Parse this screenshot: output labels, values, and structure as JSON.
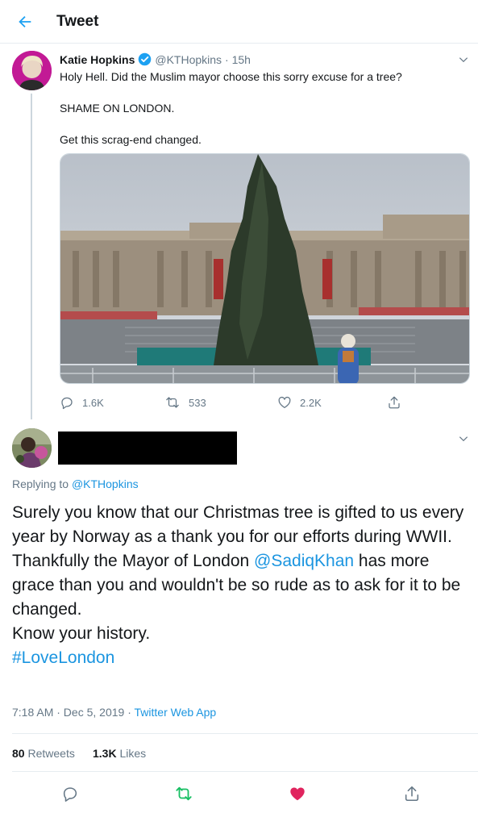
{
  "header": {
    "title": "Tweet"
  },
  "tweet1": {
    "name": "Katie Hopkins",
    "handle": "@KTHopkins",
    "time": "· 15h",
    "lines": [
      "Holy Hell. Did the Muslim mayor choose this sorry excuse for a tree?",
      "SHAME ON LONDON.",
      "Get this scrag-end changed."
    ],
    "replies": "1.6K",
    "retweets": "533",
    "likes": "2.2K"
  },
  "tweet2": {
    "replying_prefix": "Replying to",
    "replying_handle": "@KTHopkins",
    "body_1": "Surely you know that our Christmas tree is gifted to us every year by Norway as a thank you for our efforts during WWII.",
    "body_2a": "Thankfully the Mayor of London ",
    "body_2_mention": "@SadiqKhan",
    "body_2b": " has more grace than you and wouldn't be so rude as to ask for it to be changed.",
    "body_3": "Know your history.",
    "hashtag": "#LoveLondon",
    "timestamp": "7:18 AM · Dec 5, 2019 · ",
    "source": "Twitter Web App",
    "retweets_count": "80",
    "retweets_label": "Retweets",
    "likes_count": "1.3K",
    "likes_label": "Likes"
  },
  "colors": {
    "accent": "#1da1f2",
    "retweeted": "#17bf63",
    "liked": "#e0245e",
    "muted": "#657786"
  }
}
